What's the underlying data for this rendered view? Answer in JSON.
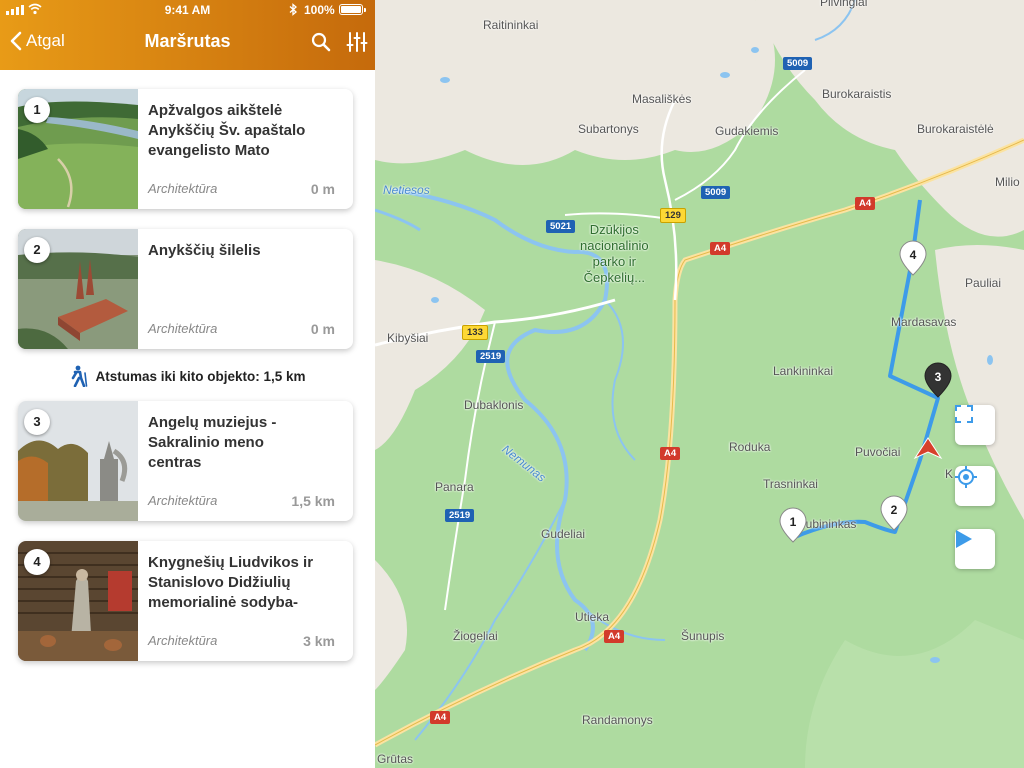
{
  "status_bar": {
    "time": "9:41 AM",
    "battery": "100%"
  },
  "header": {
    "back_label": "Atgal",
    "title": "Maršrutas"
  },
  "route_items": [
    {
      "number": "1",
      "name": "Apžvalgos aikštelė Anykščių Šv. apaštalo evangelisto Mato",
      "category": "Architektūra",
      "distance": "0 m"
    },
    {
      "number": "2",
      "name": "Anykščių šilelis",
      "category": "Architektūra",
      "distance": "0 m"
    },
    {
      "number": "3",
      "name": "Angelų muziejus - Sakralinio meno centras",
      "category": "Architektūra",
      "distance": "1,5 km"
    },
    {
      "number": "4",
      "name": "Knygnešių Liudvikos ir Stanislovo Didžiulių memorialinė sodyba-",
      "category": "Architektūra",
      "distance": "3 km"
    }
  ],
  "next_object_distance": "Atstumas iki kito objekto: 1,5 km",
  "map": {
    "places": {
      "raitininkai": "Raitininkai",
      "pilvingiai": "Pilvingiai",
      "masaliskes": "Masališkės",
      "burokaraistis": "Burokaraistis",
      "subartonys": "Subartonys",
      "gudakiemis": "Gudakiemis",
      "burokaraistele": "Burokaraistėlė",
      "milioniai": "Milio",
      "netiesos": "Netiesos",
      "park": "Dzūkijos\nnacionalinio\nparko ir\nČepkelių...",
      "pauliai": "Pauliai",
      "kibysiai": "Kibyšiai",
      "mardasavas": "Mardasavas",
      "lankininkai": "Lankininkai",
      "dubaklonis": "Dubaklonis",
      "roduka": "Roduka",
      "puvociai": "Puvočiai",
      "trasninkai": "Trasninkai",
      "panara": "Panara",
      "dubininkas": "Dubininkas",
      "gudeliai": "Gudeliai",
      "utieka": "Utieka",
      "ziogeliai": "Žiogeliai",
      "sunupis": "Šunupis",
      "randamonys": "Randamonys",
      "grutas": "Grūtas",
      "nemunas": "Nemunas",
      "k": "K"
    },
    "shields": {
      "s5009a": "5009",
      "s5009b": "5009",
      "s5021": "5021",
      "s129": "129",
      "a4_1": "A4",
      "a4_2": "A4",
      "a4_3": "A4",
      "a4_4": "A4",
      "a4_5": "A4",
      "s133": "133",
      "s2519a": "2519",
      "s2519b": "2519"
    },
    "markers": [
      "1",
      "2",
      "3",
      "4"
    ],
    "colors": {
      "route": "#3d9be9",
      "park": "#aedba0",
      "urban": "#ece8e0",
      "river": "#8cc4f0",
      "road": "#fbe3a1"
    }
  }
}
